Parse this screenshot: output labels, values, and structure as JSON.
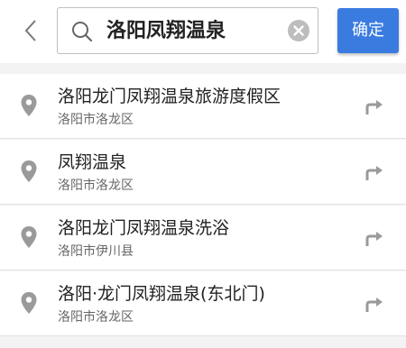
{
  "search": {
    "query": "洛阳凤翔温泉",
    "confirm_label": "确定"
  },
  "results": [
    {
      "title": "洛阳龙门凤翔温泉旅游度假区",
      "district": "洛阳市洛龙区"
    },
    {
      "title": "凤翔温泉",
      "district": "洛阳市洛龙区"
    },
    {
      "title": "洛阳龙门凤翔温泉洗浴",
      "district": "洛阳市伊川县"
    },
    {
      "title": "洛阳·龙门凤翔温泉(东北门)",
      "district": "洛阳市洛龙区"
    }
  ],
  "icons": {
    "back": "chevron-left-icon",
    "search": "search-icon",
    "clear": "clear-circle-icon",
    "pin": "location-pin-icon",
    "route": "route-arrow-icon"
  },
  "colors": {
    "accent": "#3a7be0",
    "background": "#f3f3f3"
  }
}
